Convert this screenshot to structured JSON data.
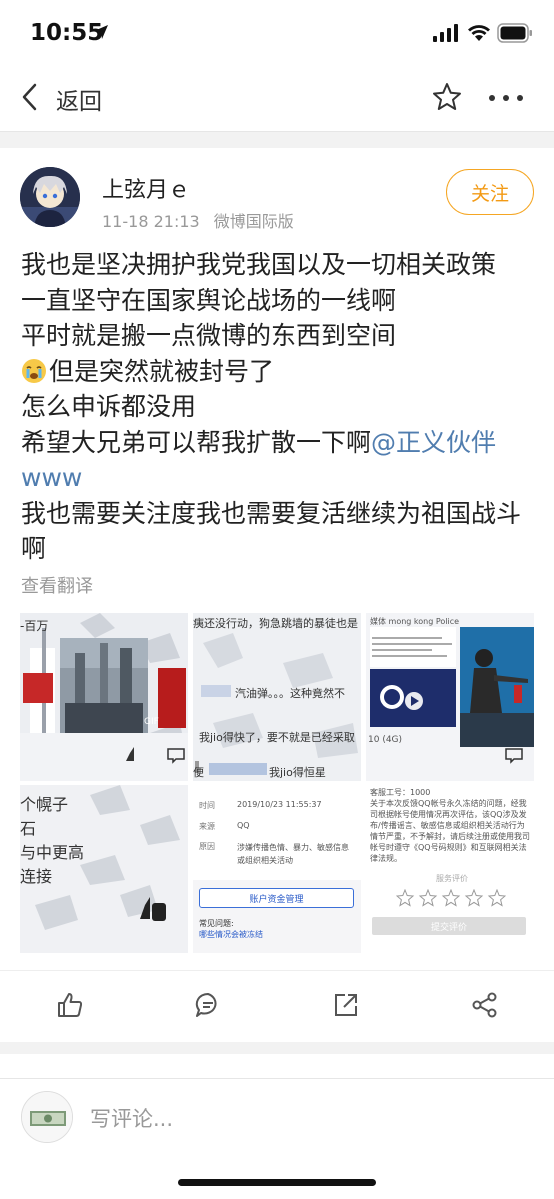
{
  "status_bar": {
    "time": "10:55"
  },
  "nav": {
    "back_label": "返回"
  },
  "post": {
    "username": "上弦月ｅ",
    "timestamp": "11-18 21:13",
    "source": "微博国际版",
    "follow_label": "关注",
    "lines": [
      "我也是坚决拥护我党我国以及一切相关政策",
      "一直坚守在国家舆论战场的一线啊",
      "平时就是搬一点微博的东西到空间",
      "但是突然就被封号了",
      "怎么申诉都没用",
      "希望大兄弟可以帮我扩散一下啊",
      "www",
      "我也需要关注度我也需要复活继续为祖国战斗",
      "啊"
    ],
    "mention": "@正义伙伴",
    "translate_label": "查看翻译"
  },
  "images": {
    "tile1": {
      "caption": "-百万",
      "gif": "GIF"
    },
    "tile2": {
      "line1": "痍还没行动，狗急跳墙的暴徒也是",
      "line2": "汽油弹。。。这种竟然不",
      "line3": "我jio得快了，要不就是已经采取",
      "line4": "我jio得恒星",
      "line4_prefix": "便"
    },
    "tile3": {
      "header": "媒体 mong kong Police",
      "video_label": "10 (4G)"
    },
    "tile4": {
      "lines": [
        "个幌子",
        "石",
        "与中更高",
        "连接"
      ]
    },
    "tile5": {
      "rows": [
        {
          "label": "时间",
          "value": "2019/10/23 11:55:37"
        },
        {
          "label": "来源",
          "value": "QQ"
        },
        {
          "label": "原因",
          "value": "涉嫌传播色情、暴力、敏感信息或组织相关活动"
        }
      ],
      "button": "账户资金管理",
      "faq_title": "常见问题:",
      "faq_link": "哪些情况会被冻结"
    },
    "tile6": {
      "service_no": "客服工号：1000",
      "body": "关于本次反馈QQ帐号永久冻结的问题，经我司根据帐号使用情况再次评估，该QQ涉及发布/传播谣言、敏感信息或组织相关活动行为情节严重，不予解封，请后续注册或使用我司帐号时遵守《QQ号码规则》和互联网相关法律法规。",
      "rating_label": "服务评价",
      "submit": "提交评价"
    }
  },
  "comment": {
    "placeholder": "写评论..."
  },
  "colors": {
    "accent": "#f39a14",
    "link": "#507daf",
    "muted": "#999999"
  }
}
